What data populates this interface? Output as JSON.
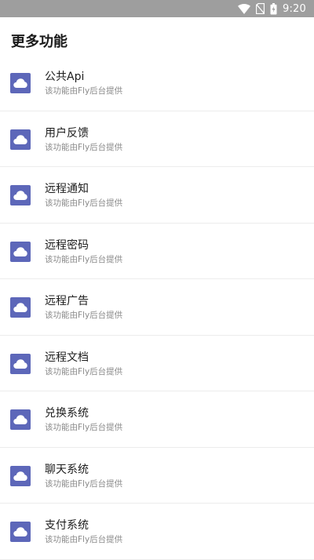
{
  "status_bar": {
    "time": "9:20",
    "icons": [
      "wifi-icon",
      "no-sim-icon",
      "battery-icon"
    ]
  },
  "header": {
    "title": "更多功能"
  },
  "features": [
    {
      "title": "公共Api",
      "subtitle": "该功能由Fly后台提供",
      "icon": "cloud-icon"
    },
    {
      "title": "用户反馈",
      "subtitle": "该功能由Fly后台提供",
      "icon": "cloud-icon"
    },
    {
      "title": "远程通知",
      "subtitle": "该功能由Fly后台提供",
      "icon": "cloud-icon"
    },
    {
      "title": "远程密码",
      "subtitle": "该功能由Fly后台提供",
      "icon": "cloud-icon"
    },
    {
      "title": "远程广告",
      "subtitle": "该功能由Fly后台提供",
      "icon": "cloud-icon"
    },
    {
      "title": "远程文档",
      "subtitle": "该功能由Fly后台提供",
      "icon": "cloud-icon"
    },
    {
      "title": "兑换系统",
      "subtitle": "该功能由Fly后台提供",
      "icon": "cloud-icon"
    },
    {
      "title": "聊天系统",
      "subtitle": "该功能由Fly后台提供",
      "icon": "cloud-icon"
    },
    {
      "title": "支付系统",
      "subtitle": "该功能由Fly后台提供",
      "icon": "cloud-icon"
    }
  ],
  "colors": {
    "status_bar": "#9e9e9e",
    "icon_background": "#5d67b9",
    "icon_foreground": "#ffffff",
    "title_text": "#1c1c1c",
    "subtitle_text": "#8a8a8a",
    "divider": "#ececec"
  }
}
